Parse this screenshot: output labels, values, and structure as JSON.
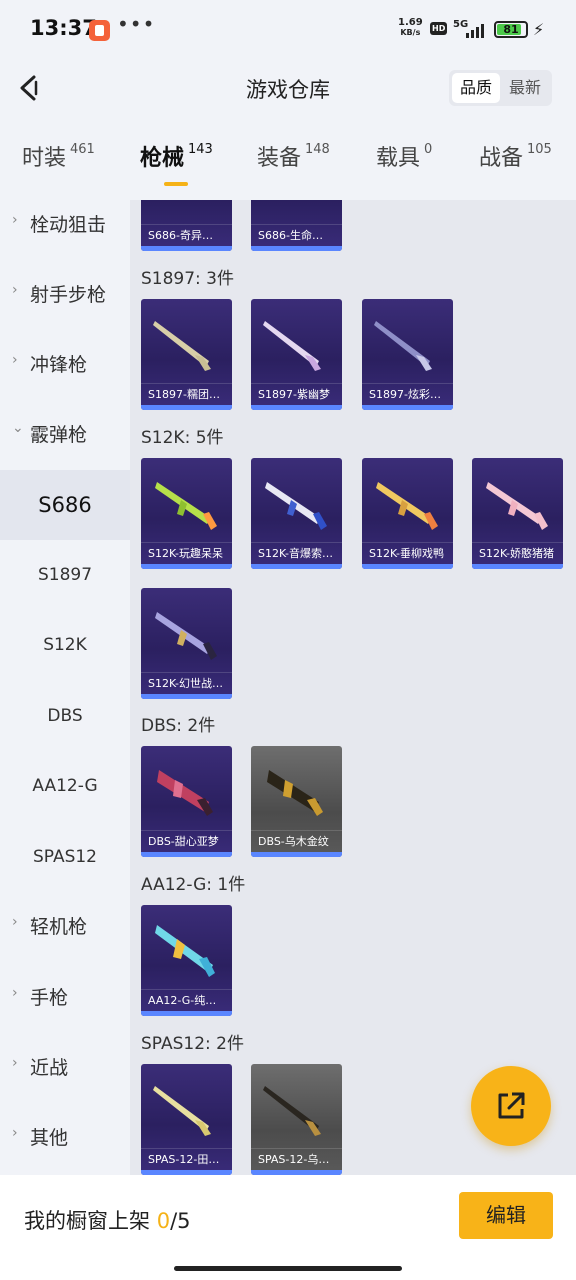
{
  "status_bar": {
    "time": "13:37",
    "more": "•••",
    "net_speed_value": "1.69",
    "net_speed_unit": "KB/s",
    "hd": "HD",
    "network": "5G",
    "battery": "81"
  },
  "header": {
    "title": "游戏仓库",
    "sort_options": [
      "品质",
      "最新"
    ],
    "sort_selected": "品质"
  },
  "tabs": [
    {
      "label": "时装",
      "count": "461"
    },
    {
      "label": "枪械",
      "count": "143",
      "active": true
    },
    {
      "label": "装备",
      "count": "148"
    },
    {
      "label": "载具",
      "count": "0"
    },
    {
      "label": "战备",
      "count": "105"
    }
  ],
  "sidebar": {
    "groups": [
      "栓动狙击",
      "射手步枪",
      "冲锋枪",
      "霰弹枪"
    ],
    "shotgun_subs": [
      "S686",
      "S1897",
      "S12K",
      "DBS",
      "AA12-G",
      "SPAS12"
    ],
    "active_sub": "S686",
    "more_groups": [
      "轻机枪",
      "手枪",
      "近战",
      "其他"
    ]
  },
  "content": {
    "s686_items": [
      "S686-奇异…",
      "S686-生命…"
    ],
    "sections": [
      {
        "title": "S1897: 3件",
        "items": [
          "S1897-糯团…",
          "S1897-紫幽梦",
          "S1897-炫彩…"
        ]
      },
      {
        "title": "S12K: 5件",
        "items": [
          "S12K-玩趣呆呆",
          "S12K-音爆索…",
          "S12K-垂柳戏鸭",
          "S12K-娇憨猪猪",
          "S12K-幻世战…"
        ]
      },
      {
        "title": "DBS: 2件",
        "items": [
          "DBS-甜心亚梦",
          "DBS-乌木金纹"
        ]
      },
      {
        "title": "AA12-G: 1件",
        "items": [
          "AA12-G-纯…"
        ]
      },
      {
        "title": "SPAS12: 2件",
        "items": [
          "SPAS-12-田…",
          "SPAS-12-乌…"
        ]
      }
    ]
  },
  "bottom_bar": {
    "shelf_label": "我的橱窗上架",
    "shelf_current": "0",
    "shelf_total": "/5",
    "edit_label": "编辑"
  },
  "colors": {
    "accent": "#f8b318",
    "card_purple": "#2b2060",
    "card_gray": "#555555",
    "card_bar": "#5a86ff"
  }
}
